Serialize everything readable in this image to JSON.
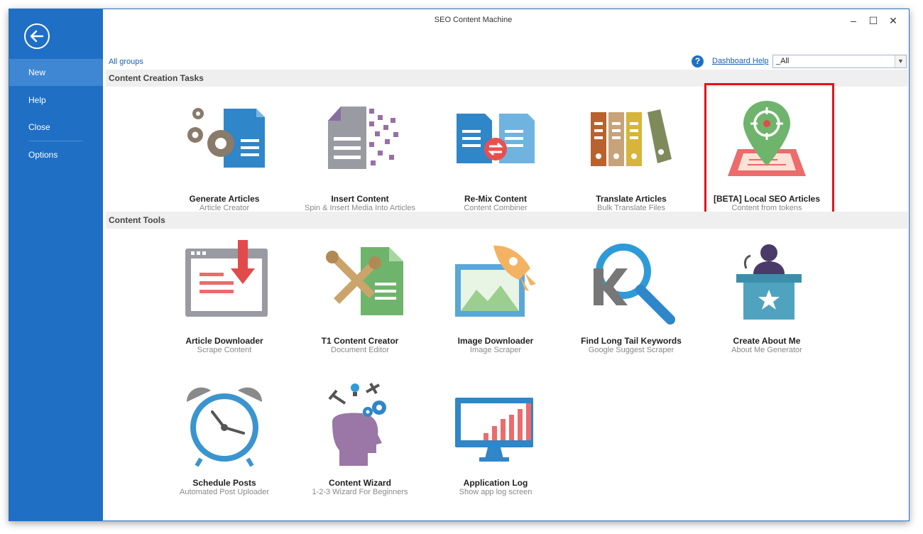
{
  "window": {
    "title": "SEO Content Machine"
  },
  "sidebar": {
    "items": [
      {
        "label": "New"
      },
      {
        "label": "Help"
      },
      {
        "label": "Close"
      },
      {
        "label": "Options"
      }
    ]
  },
  "toolbar": {
    "all_groups": "All groups",
    "dashboard_help": "Dashboard Help",
    "group_filter": "_All"
  },
  "sections": [
    {
      "title": "Content Creation Tasks",
      "tiles": [
        {
          "title": "Generate Articles",
          "subtitle": "Article Creator",
          "icon": "gears-document-icon"
        },
        {
          "title": "Insert Content",
          "subtitle": "Spin & Insert Media Into Articles",
          "icon": "pixel-document-icon"
        },
        {
          "title": "Re-Mix Content",
          "subtitle": "Content Combiner",
          "icon": "document-swap-icon"
        },
        {
          "title": "Translate Articles",
          "subtitle": "Bulk Translate Files",
          "icon": "binders-icon"
        },
        {
          "title": "[BETA] Local SEO Articles",
          "subtitle": "Content from tokens",
          "icon": "map-pin-icon"
        }
      ]
    },
    {
      "title": "Content Tools",
      "tiles": [
        {
          "title": "Article Downloader",
          "subtitle": "Scrape Content",
          "icon": "browser-download-icon"
        },
        {
          "title": "T1 Content Creator",
          "subtitle": "Document Editor",
          "icon": "tools-document-icon"
        },
        {
          "title": "Image Downloader",
          "subtitle": "Image Scraper",
          "icon": "rocket-image-icon"
        },
        {
          "title": "Find Long Tail Keywords",
          "subtitle": "Google Suggest Scraper",
          "icon": "magnifier-k-icon"
        },
        {
          "title": "Create About Me",
          "subtitle": "About Me Generator",
          "icon": "podium-speaker-icon"
        },
        {
          "title": "Schedule Posts",
          "subtitle": "Automated Post Uploader",
          "icon": "alarm-clock-icon"
        },
        {
          "title": "Content Wizard",
          "subtitle": "1-2-3 Wizard For Beginners",
          "icon": "head-gears-icon"
        },
        {
          "title": "Application Log",
          "subtitle": "Show app log screen",
          "icon": "monitor-chart-icon"
        }
      ]
    }
  ],
  "colors": {
    "sidebar": "#1f6fc5",
    "sidebar_active": "#3f86d3",
    "highlight": "#e2131b",
    "link": "#1a5fb0"
  }
}
